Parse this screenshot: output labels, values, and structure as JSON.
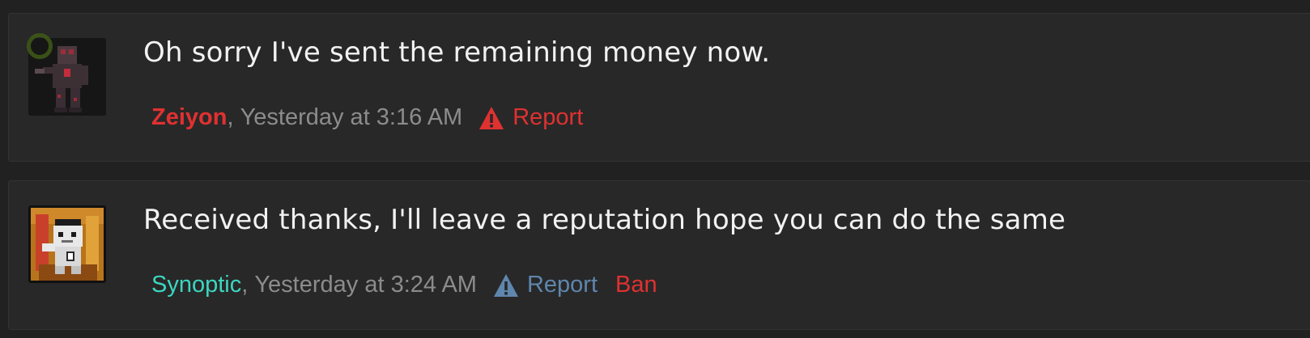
{
  "messages": [
    {
      "text": "Oh sorry I've sent the remaining money now.",
      "username": "Zeiyon",
      "username_color": "#e03131",
      "separator": ",",
      "timestamp": "Yesterday at 3:16 AM",
      "report_label": "Report",
      "report_color": "#e03131"
    },
    {
      "text": "Received thanks, I'll leave a reputation hope you can do the same",
      "username": "Synoptic",
      "username_color": "#3cd6c0",
      "separator": ",",
      "timestamp": "Yesterday at 3:24 AM",
      "report_label": "Report",
      "report_color": "#5f86ad",
      "ban_label": "Ban"
    }
  ],
  "icons": {
    "report": "warning-triangle-icon"
  }
}
